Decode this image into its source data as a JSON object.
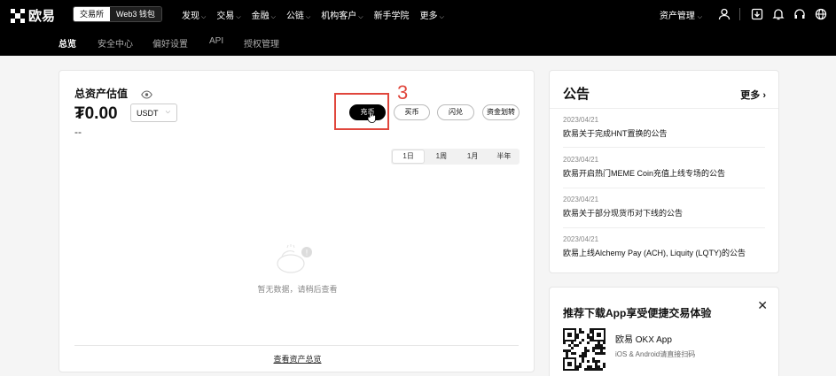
{
  "topbar": {
    "logo_text": "欧易",
    "seg_exchange": "交易所",
    "seg_web3": "Web3 钱包",
    "nav": [
      "发现",
      "交易",
      "金融",
      "公链",
      "机构客户",
      "新手学院",
      "更多"
    ],
    "nav_has_chevron": [
      true,
      true,
      true,
      true,
      true,
      false,
      true
    ],
    "asset_manage": "资产管理"
  },
  "subnav": {
    "items": [
      "总览",
      "安全中心",
      "偏好设置",
      "API",
      "授权管理"
    ]
  },
  "overview": {
    "title": "总资产估值",
    "amount": "₮0.00",
    "currency": "USDT",
    "change": "--",
    "buttons": {
      "deposit": "充币",
      "buy": "买币",
      "convert": "闪兑",
      "transfer": "资金划转"
    },
    "annotation_step": "3",
    "ranges": [
      "1日",
      "1周",
      "1月",
      "半年"
    ],
    "selected_range": "1日",
    "empty_text": "暂无数据，请稍后查看",
    "view_link": "查看资产总览"
  },
  "announcements": {
    "title": "公告",
    "more": "更多",
    "items": [
      {
        "date": "2023/04/21",
        "text": "欧易关于完成HNT置换的公告"
      },
      {
        "date": "2023/04/21",
        "text": "欧易开启热门MEME Coin充值上线专场的公告"
      },
      {
        "date": "2023/04/21",
        "text": "欧易关于部分现货币对下线的公告"
      },
      {
        "date": "2023/04/21",
        "text": "欧易上线Alchemy Pay (ACH), Liquity (LQTY)的公告"
      }
    ]
  },
  "app_download": {
    "title": "推荐下载App享受便捷交易体验",
    "app_name": "欧易 OKX App",
    "app_sub": "iOS & Android请直接扫码"
  },
  "colors": {
    "accent_red": "#e0463c",
    "topbar_bg": "#000000"
  }
}
